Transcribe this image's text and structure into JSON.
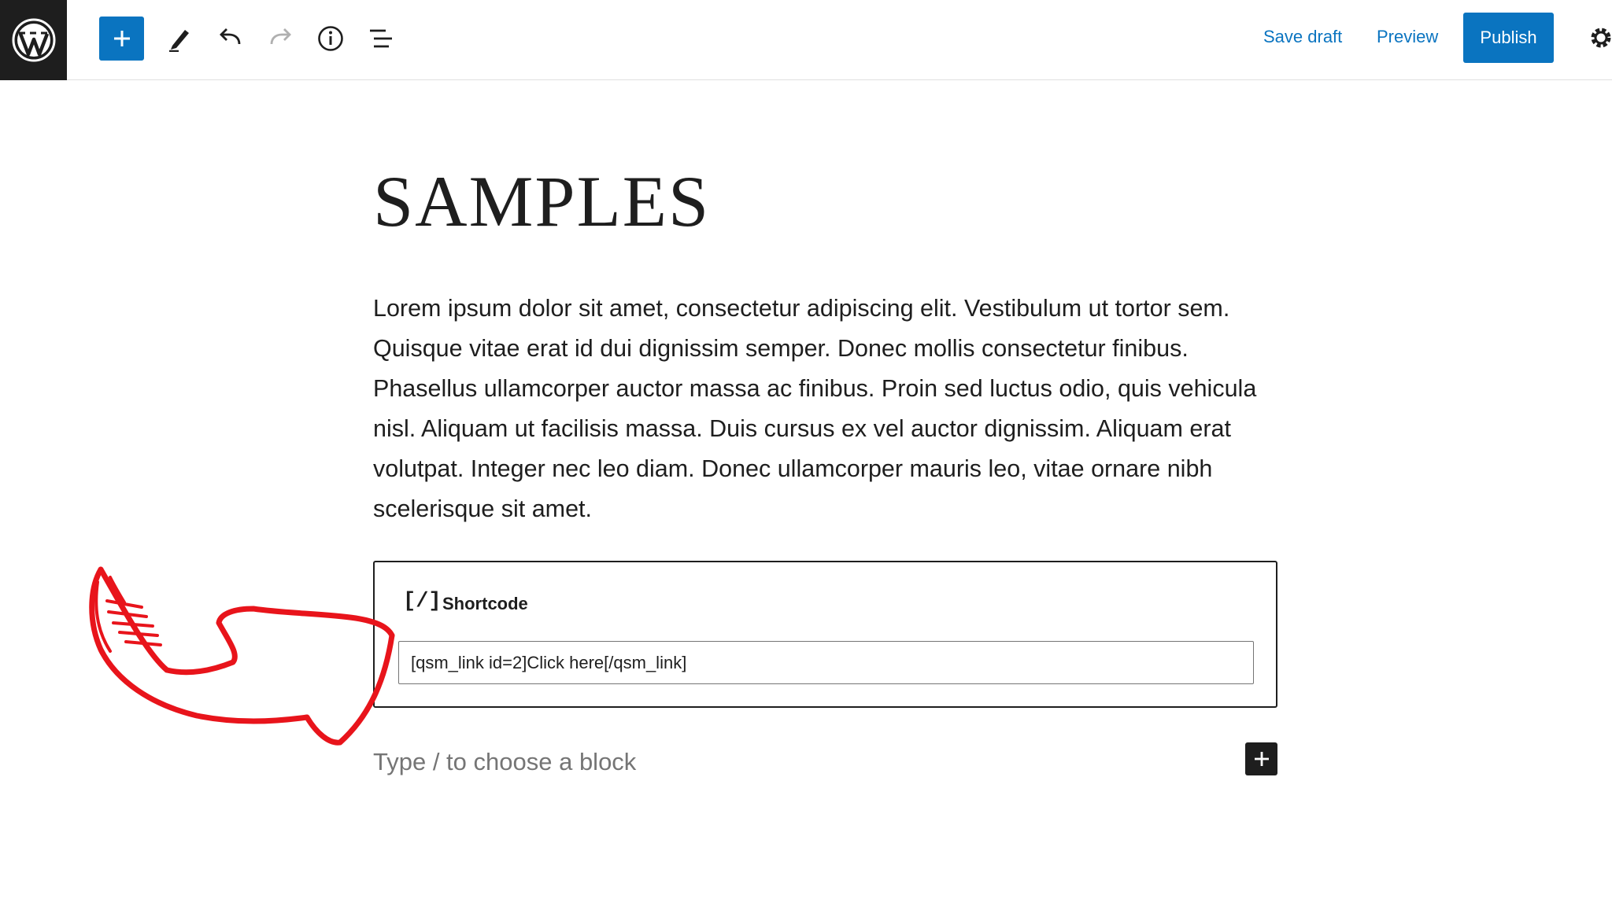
{
  "toolbar": {
    "logo_icon": "wordpress-logo-icon",
    "add_block_icon": "plus-icon",
    "tools": [
      {
        "name": "edit-tool",
        "icon": "pencil-icon"
      },
      {
        "name": "undo",
        "icon": "undo-icon"
      },
      {
        "name": "redo",
        "icon": "redo-icon"
      },
      {
        "name": "details",
        "icon": "info-icon"
      },
      {
        "name": "list-view",
        "icon": "list-view-icon"
      }
    ],
    "save_draft_label": "Save draft",
    "preview_label": "Preview",
    "publish_label": "Publish",
    "settings_icon": "gear-icon",
    "accent_color": "#0a74c0"
  },
  "post": {
    "title": "SAMPLES",
    "paragraph": "Lorem ipsum dolor sit amet, consectetur adipiscing elit. Vestibulum ut tortor sem. Quisque vitae erat id dui dignissim semper. Donec mollis consectetur finibus. Phasellus ullamcorper auctor massa ac finibus. Proin sed luctus odio, quis vehicula nisl. Aliquam ut facilisis massa. Duis cursus ex vel auctor dignissim. Aliquam erat volutpat. Integer nec leo diam. Donec ullamcorper mauris leo, vitae ornare nibh scelerisque sit amet."
  },
  "shortcode_block": {
    "icon_text": "[/]",
    "label": "Shortcode",
    "value": "[qsm_link id=2]Click here[/qsm_link]"
  },
  "appender": {
    "placeholder": "Type / to choose a block",
    "inserter_icon": "plus-icon"
  },
  "annotation": {
    "type": "hand-drawn-arrow",
    "color": "#e8141b"
  }
}
